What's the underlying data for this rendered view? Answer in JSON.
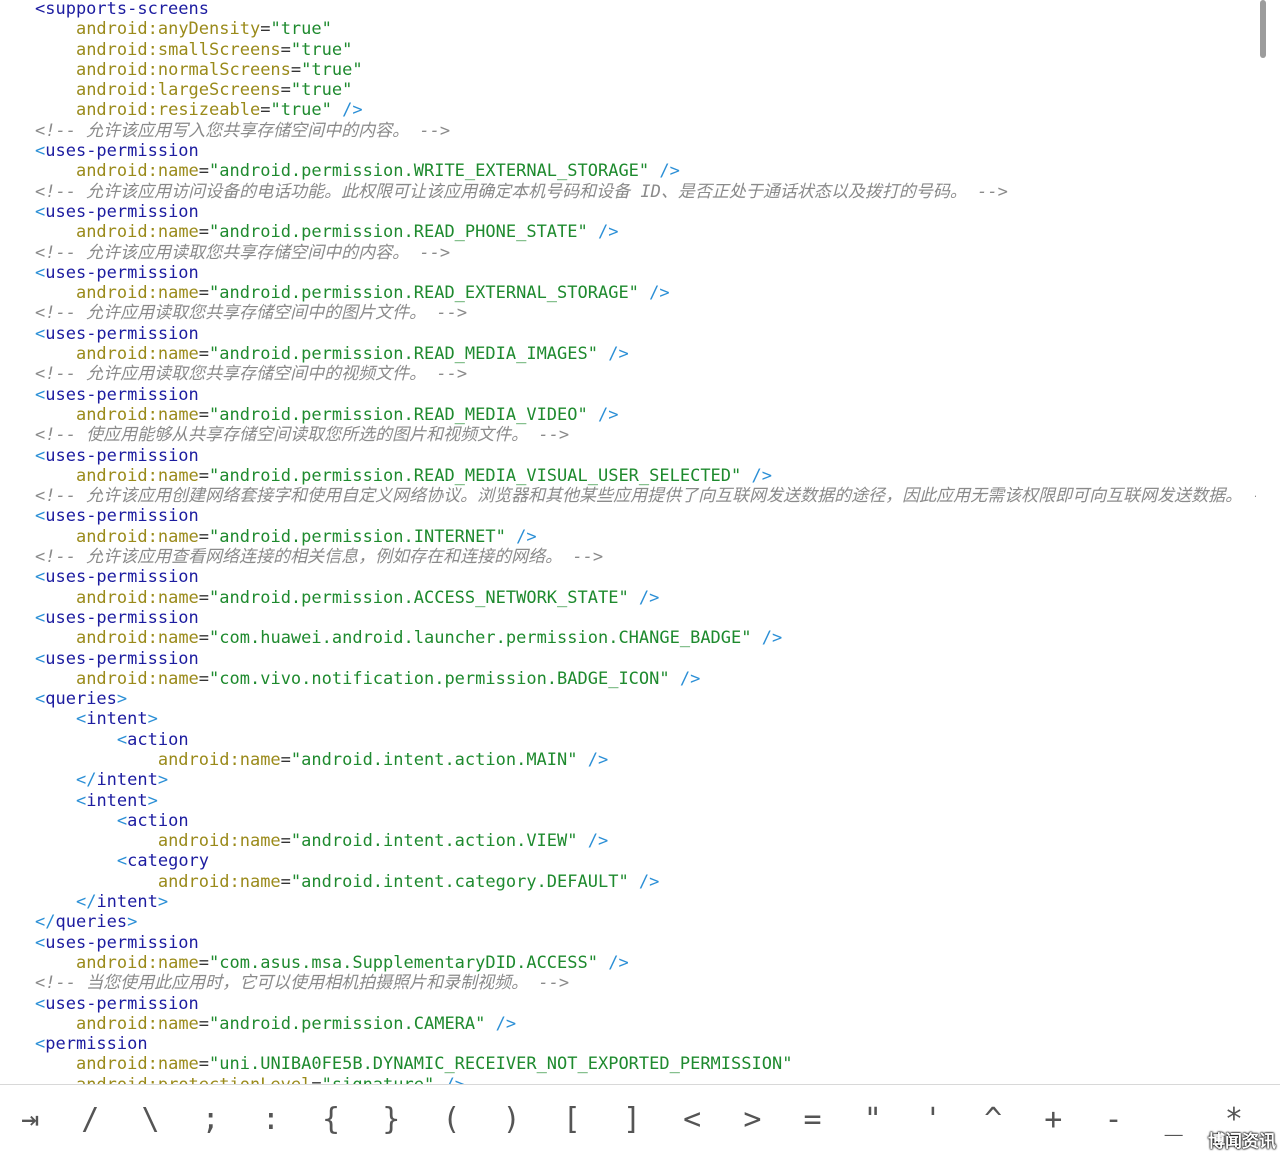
{
  "code_lines": [
    [
      {
        "t": "tag",
        "v": "<supports-screens"
      }
    ],
    [
      {
        "t": "sp",
        "v": "    "
      },
      {
        "t": "ans",
        "v": "android:"
      },
      {
        "t": "attr",
        "v": "anyDensity"
      },
      {
        "t": "eq",
        "v": "="
      },
      {
        "t": "str",
        "v": "\"true\""
      }
    ],
    [
      {
        "t": "sp",
        "v": "    "
      },
      {
        "t": "ans",
        "v": "android:"
      },
      {
        "t": "attr",
        "v": "smallScreens"
      },
      {
        "t": "eq",
        "v": "="
      },
      {
        "t": "str",
        "v": "\"true\""
      }
    ],
    [
      {
        "t": "sp",
        "v": "    "
      },
      {
        "t": "ans",
        "v": "android:"
      },
      {
        "t": "attr",
        "v": "normalScreens"
      },
      {
        "t": "eq",
        "v": "="
      },
      {
        "t": "str",
        "v": "\"true\""
      }
    ],
    [
      {
        "t": "sp",
        "v": "    "
      },
      {
        "t": "ans",
        "v": "android:"
      },
      {
        "t": "attr",
        "v": "largeScreens"
      },
      {
        "t": "eq",
        "v": "="
      },
      {
        "t": "str",
        "v": "\"true\""
      }
    ],
    [
      {
        "t": "sp",
        "v": "    "
      },
      {
        "t": "ans",
        "v": "android:"
      },
      {
        "t": "attr",
        "v": "resizeable"
      },
      {
        "t": "eq",
        "v": "="
      },
      {
        "t": "str",
        "v": "\"true\""
      },
      {
        "t": "punct",
        "v": " />"
      }
    ],
    [
      {
        "t": "comment",
        "v": "<!-- 允许该应用写入您共享存储空间中的内容。 -->"
      }
    ],
    [
      {
        "t": "punct",
        "v": "<"
      },
      {
        "t": "tag",
        "v": "uses-permission"
      }
    ],
    [
      {
        "t": "sp",
        "v": "    "
      },
      {
        "t": "ans",
        "v": "android:"
      },
      {
        "t": "attr",
        "v": "name"
      },
      {
        "t": "eq",
        "v": "="
      },
      {
        "t": "str",
        "v": "\"android.permission.WRITE_EXTERNAL_STORAGE\""
      },
      {
        "t": "punct",
        "v": " />"
      }
    ],
    [
      {
        "t": "comment",
        "v": "<!-- 允许该应用访问设备的电话功能。此权限可让该应用确定本机号码和设备 ID、是否正处于通话状态以及拨打的号码。 -->"
      }
    ],
    [
      {
        "t": "punct",
        "v": "<"
      },
      {
        "t": "tag",
        "v": "uses-permission"
      }
    ],
    [
      {
        "t": "sp",
        "v": "    "
      },
      {
        "t": "ans",
        "v": "android:"
      },
      {
        "t": "attr",
        "v": "name"
      },
      {
        "t": "eq",
        "v": "="
      },
      {
        "t": "str",
        "v": "\"android.permission.READ_PHONE_STATE\""
      },
      {
        "t": "punct",
        "v": " />"
      }
    ],
    [
      {
        "t": "comment",
        "v": "<!-- 允许该应用读取您共享存储空间中的内容。 -->"
      }
    ],
    [
      {
        "t": "punct",
        "v": "<"
      },
      {
        "t": "tag",
        "v": "uses-permission"
      }
    ],
    [
      {
        "t": "sp",
        "v": "    "
      },
      {
        "t": "ans",
        "v": "android:"
      },
      {
        "t": "attr",
        "v": "name"
      },
      {
        "t": "eq",
        "v": "="
      },
      {
        "t": "str",
        "v": "\"android.permission.READ_EXTERNAL_STORAGE\""
      },
      {
        "t": "punct",
        "v": " />"
      }
    ],
    [
      {
        "t": "comment",
        "v": "<!-- 允许应用读取您共享存储空间中的图片文件。 -->"
      }
    ],
    [
      {
        "t": "punct",
        "v": "<"
      },
      {
        "t": "tag",
        "v": "uses-permission"
      }
    ],
    [
      {
        "t": "sp",
        "v": "    "
      },
      {
        "t": "ans",
        "v": "android:"
      },
      {
        "t": "attr",
        "v": "name"
      },
      {
        "t": "eq",
        "v": "="
      },
      {
        "t": "str",
        "v": "\"android.permission.READ_MEDIA_IMAGES\""
      },
      {
        "t": "punct",
        "v": " />"
      }
    ],
    [
      {
        "t": "comment",
        "v": "<!-- 允许应用读取您共享存储空间中的视频文件。 -->"
      }
    ],
    [
      {
        "t": "punct",
        "v": "<"
      },
      {
        "t": "tag",
        "v": "uses-permission"
      }
    ],
    [
      {
        "t": "sp",
        "v": "    "
      },
      {
        "t": "ans",
        "v": "android:"
      },
      {
        "t": "attr",
        "v": "name"
      },
      {
        "t": "eq",
        "v": "="
      },
      {
        "t": "str",
        "v": "\"android.permission.READ_MEDIA_VIDEO\""
      },
      {
        "t": "punct",
        "v": " />"
      }
    ],
    [
      {
        "t": "comment",
        "v": "<!-- 使应用能够从共享存储空间读取您所选的图片和视频文件。 -->"
      }
    ],
    [
      {
        "t": "punct",
        "v": "<"
      },
      {
        "t": "tag",
        "v": "uses-permission"
      }
    ],
    [
      {
        "t": "sp",
        "v": "    "
      },
      {
        "t": "ans",
        "v": "android:"
      },
      {
        "t": "attr",
        "v": "name"
      },
      {
        "t": "eq",
        "v": "="
      },
      {
        "t": "str",
        "v": "\"android.permission.READ_MEDIA_VISUAL_USER_SELECTED\""
      },
      {
        "t": "punct",
        "v": " />"
      }
    ],
    [
      {
        "t": "comment",
        "v": "<!-- 允许该应用创建网络套接字和使用自定义网络协议。浏览器和其他某些应用提供了向互联网发送数据的途径，因此应用无需该权限即可向互联网发送数据。 -->"
      }
    ],
    [
      {
        "t": "punct",
        "v": "<"
      },
      {
        "t": "tag",
        "v": "uses-permission"
      }
    ],
    [
      {
        "t": "sp",
        "v": "    "
      },
      {
        "t": "ans",
        "v": "android:"
      },
      {
        "t": "attr",
        "v": "name"
      },
      {
        "t": "eq",
        "v": "="
      },
      {
        "t": "str",
        "v": "\"android.permission.INTERNET\""
      },
      {
        "t": "punct",
        "v": " />"
      }
    ],
    [
      {
        "t": "comment",
        "v": "<!-- 允许该应用查看网络连接的相关信息，例如存在和连接的网络。 -->"
      }
    ],
    [
      {
        "t": "punct",
        "v": "<"
      },
      {
        "t": "tag",
        "v": "uses-permission"
      }
    ],
    [
      {
        "t": "sp",
        "v": "    "
      },
      {
        "t": "ans",
        "v": "android:"
      },
      {
        "t": "attr",
        "v": "name"
      },
      {
        "t": "eq",
        "v": "="
      },
      {
        "t": "str",
        "v": "\"android.permission.ACCESS_NETWORK_STATE\""
      },
      {
        "t": "punct",
        "v": " />"
      }
    ],
    [
      {
        "t": "punct",
        "v": "<"
      },
      {
        "t": "tag",
        "v": "uses-permission"
      }
    ],
    [
      {
        "t": "sp",
        "v": "    "
      },
      {
        "t": "ans",
        "v": "android:"
      },
      {
        "t": "attr",
        "v": "name"
      },
      {
        "t": "eq",
        "v": "="
      },
      {
        "t": "str",
        "v": "\"com.huawei.android.launcher.permission.CHANGE_BADGE\""
      },
      {
        "t": "punct",
        "v": " />"
      }
    ],
    [
      {
        "t": "punct",
        "v": "<"
      },
      {
        "t": "tag",
        "v": "uses-permission"
      }
    ],
    [
      {
        "t": "sp",
        "v": "    "
      },
      {
        "t": "ans",
        "v": "android:"
      },
      {
        "t": "attr",
        "v": "name"
      },
      {
        "t": "eq",
        "v": "="
      },
      {
        "t": "str",
        "v": "\"com.vivo.notification.permission.BADGE_ICON\""
      },
      {
        "t": "punct",
        "v": " />"
      }
    ],
    [
      {
        "t": "punct",
        "v": "<"
      },
      {
        "t": "tag",
        "v": "queries"
      },
      {
        "t": "punct",
        "v": ">"
      }
    ],
    [
      {
        "t": "sp",
        "v": "    "
      },
      {
        "t": "punct",
        "v": "<"
      },
      {
        "t": "tag",
        "v": "intent"
      },
      {
        "t": "punct",
        "v": ">"
      }
    ],
    [
      {
        "t": "sp",
        "v": "        "
      },
      {
        "t": "punct",
        "v": "<"
      },
      {
        "t": "tag",
        "v": "action"
      }
    ],
    [
      {
        "t": "sp",
        "v": "            "
      },
      {
        "t": "ans",
        "v": "android:"
      },
      {
        "t": "attr",
        "v": "name"
      },
      {
        "t": "eq",
        "v": "="
      },
      {
        "t": "str",
        "v": "\"android.intent.action.MAIN\""
      },
      {
        "t": "punct",
        "v": " />"
      }
    ],
    [
      {
        "t": "sp",
        "v": "    "
      },
      {
        "t": "punct",
        "v": "</"
      },
      {
        "t": "tag",
        "v": "intent"
      },
      {
        "t": "punct",
        "v": ">"
      }
    ],
    [
      {
        "t": "sp",
        "v": "    "
      },
      {
        "t": "punct",
        "v": "<"
      },
      {
        "t": "tag",
        "v": "intent"
      },
      {
        "t": "punct",
        "v": ">"
      }
    ],
    [
      {
        "t": "sp",
        "v": "        "
      },
      {
        "t": "punct",
        "v": "<"
      },
      {
        "t": "tag",
        "v": "action"
      }
    ],
    [
      {
        "t": "sp",
        "v": "            "
      },
      {
        "t": "ans",
        "v": "android:"
      },
      {
        "t": "attr",
        "v": "name"
      },
      {
        "t": "eq",
        "v": "="
      },
      {
        "t": "str",
        "v": "\"android.intent.action.VIEW\""
      },
      {
        "t": "punct",
        "v": " />"
      }
    ],
    [
      {
        "t": "sp",
        "v": "        "
      },
      {
        "t": "punct",
        "v": "<"
      },
      {
        "t": "tag",
        "v": "category"
      }
    ],
    [
      {
        "t": "sp",
        "v": "            "
      },
      {
        "t": "ans",
        "v": "android:"
      },
      {
        "t": "attr",
        "v": "name"
      },
      {
        "t": "eq",
        "v": "="
      },
      {
        "t": "str",
        "v": "\"android.intent.category.DEFAULT\""
      },
      {
        "t": "punct",
        "v": " />"
      }
    ],
    [
      {
        "t": "sp",
        "v": "    "
      },
      {
        "t": "punct",
        "v": "</"
      },
      {
        "t": "tag",
        "v": "intent"
      },
      {
        "t": "punct",
        "v": ">"
      }
    ],
    [
      {
        "t": "punct",
        "v": "</"
      },
      {
        "t": "tag",
        "v": "queries"
      },
      {
        "t": "punct",
        "v": ">"
      }
    ],
    [
      {
        "t": "punct",
        "v": "<"
      },
      {
        "t": "tag",
        "v": "uses-permission"
      }
    ],
    [
      {
        "t": "sp",
        "v": "    "
      },
      {
        "t": "ans",
        "v": "android:"
      },
      {
        "t": "attr",
        "v": "name"
      },
      {
        "t": "eq",
        "v": "="
      },
      {
        "t": "str",
        "v": "\"com.asus.msa.SupplementaryDID.ACCESS\""
      },
      {
        "t": "punct",
        "v": " />"
      }
    ],
    [
      {
        "t": "comment",
        "v": "<!-- 当您使用此应用时，它可以使用相机拍摄照片和录制视频。 -->"
      }
    ],
    [
      {
        "t": "punct",
        "v": "<"
      },
      {
        "t": "tag",
        "v": "uses-permission"
      }
    ],
    [
      {
        "t": "sp",
        "v": "    "
      },
      {
        "t": "ans",
        "v": "android:"
      },
      {
        "t": "attr",
        "v": "name"
      },
      {
        "t": "eq",
        "v": "="
      },
      {
        "t": "str",
        "v": "\"android.permission.CAMERA\""
      },
      {
        "t": "punct",
        "v": " />"
      }
    ],
    [
      {
        "t": "punct",
        "v": "<"
      },
      {
        "t": "tag",
        "v": "permission"
      }
    ],
    [
      {
        "t": "sp",
        "v": "    "
      },
      {
        "t": "ans",
        "v": "android:"
      },
      {
        "t": "attr",
        "v": "name"
      },
      {
        "t": "eq",
        "v": "="
      },
      {
        "t": "str",
        "v": "\"uni.UNIBA0FE5B.DYNAMIC_RECEIVER_NOT_EXPORTED_PERMISSION\""
      }
    ],
    [
      {
        "t": "sp",
        "v": "    "
      },
      {
        "t": "ans",
        "v": "android:"
      },
      {
        "t": "attr",
        "v": "protectionLevel"
      },
      {
        "t": "eq",
        "v": "="
      },
      {
        "t": "str",
        "v": "\"signature\""
      },
      {
        "t": "punct",
        "v": " />"
      }
    ]
  ],
  "symbol_bar": {
    "keys": [
      "⇥",
      "/",
      "\\",
      ";",
      ":",
      "{",
      "}",
      "(",
      ")",
      "[",
      "]",
      "<",
      ">",
      "=",
      "\"",
      "'",
      "^",
      "+",
      "-",
      "_",
      "*"
    ]
  },
  "watermark": "博闻资讯"
}
